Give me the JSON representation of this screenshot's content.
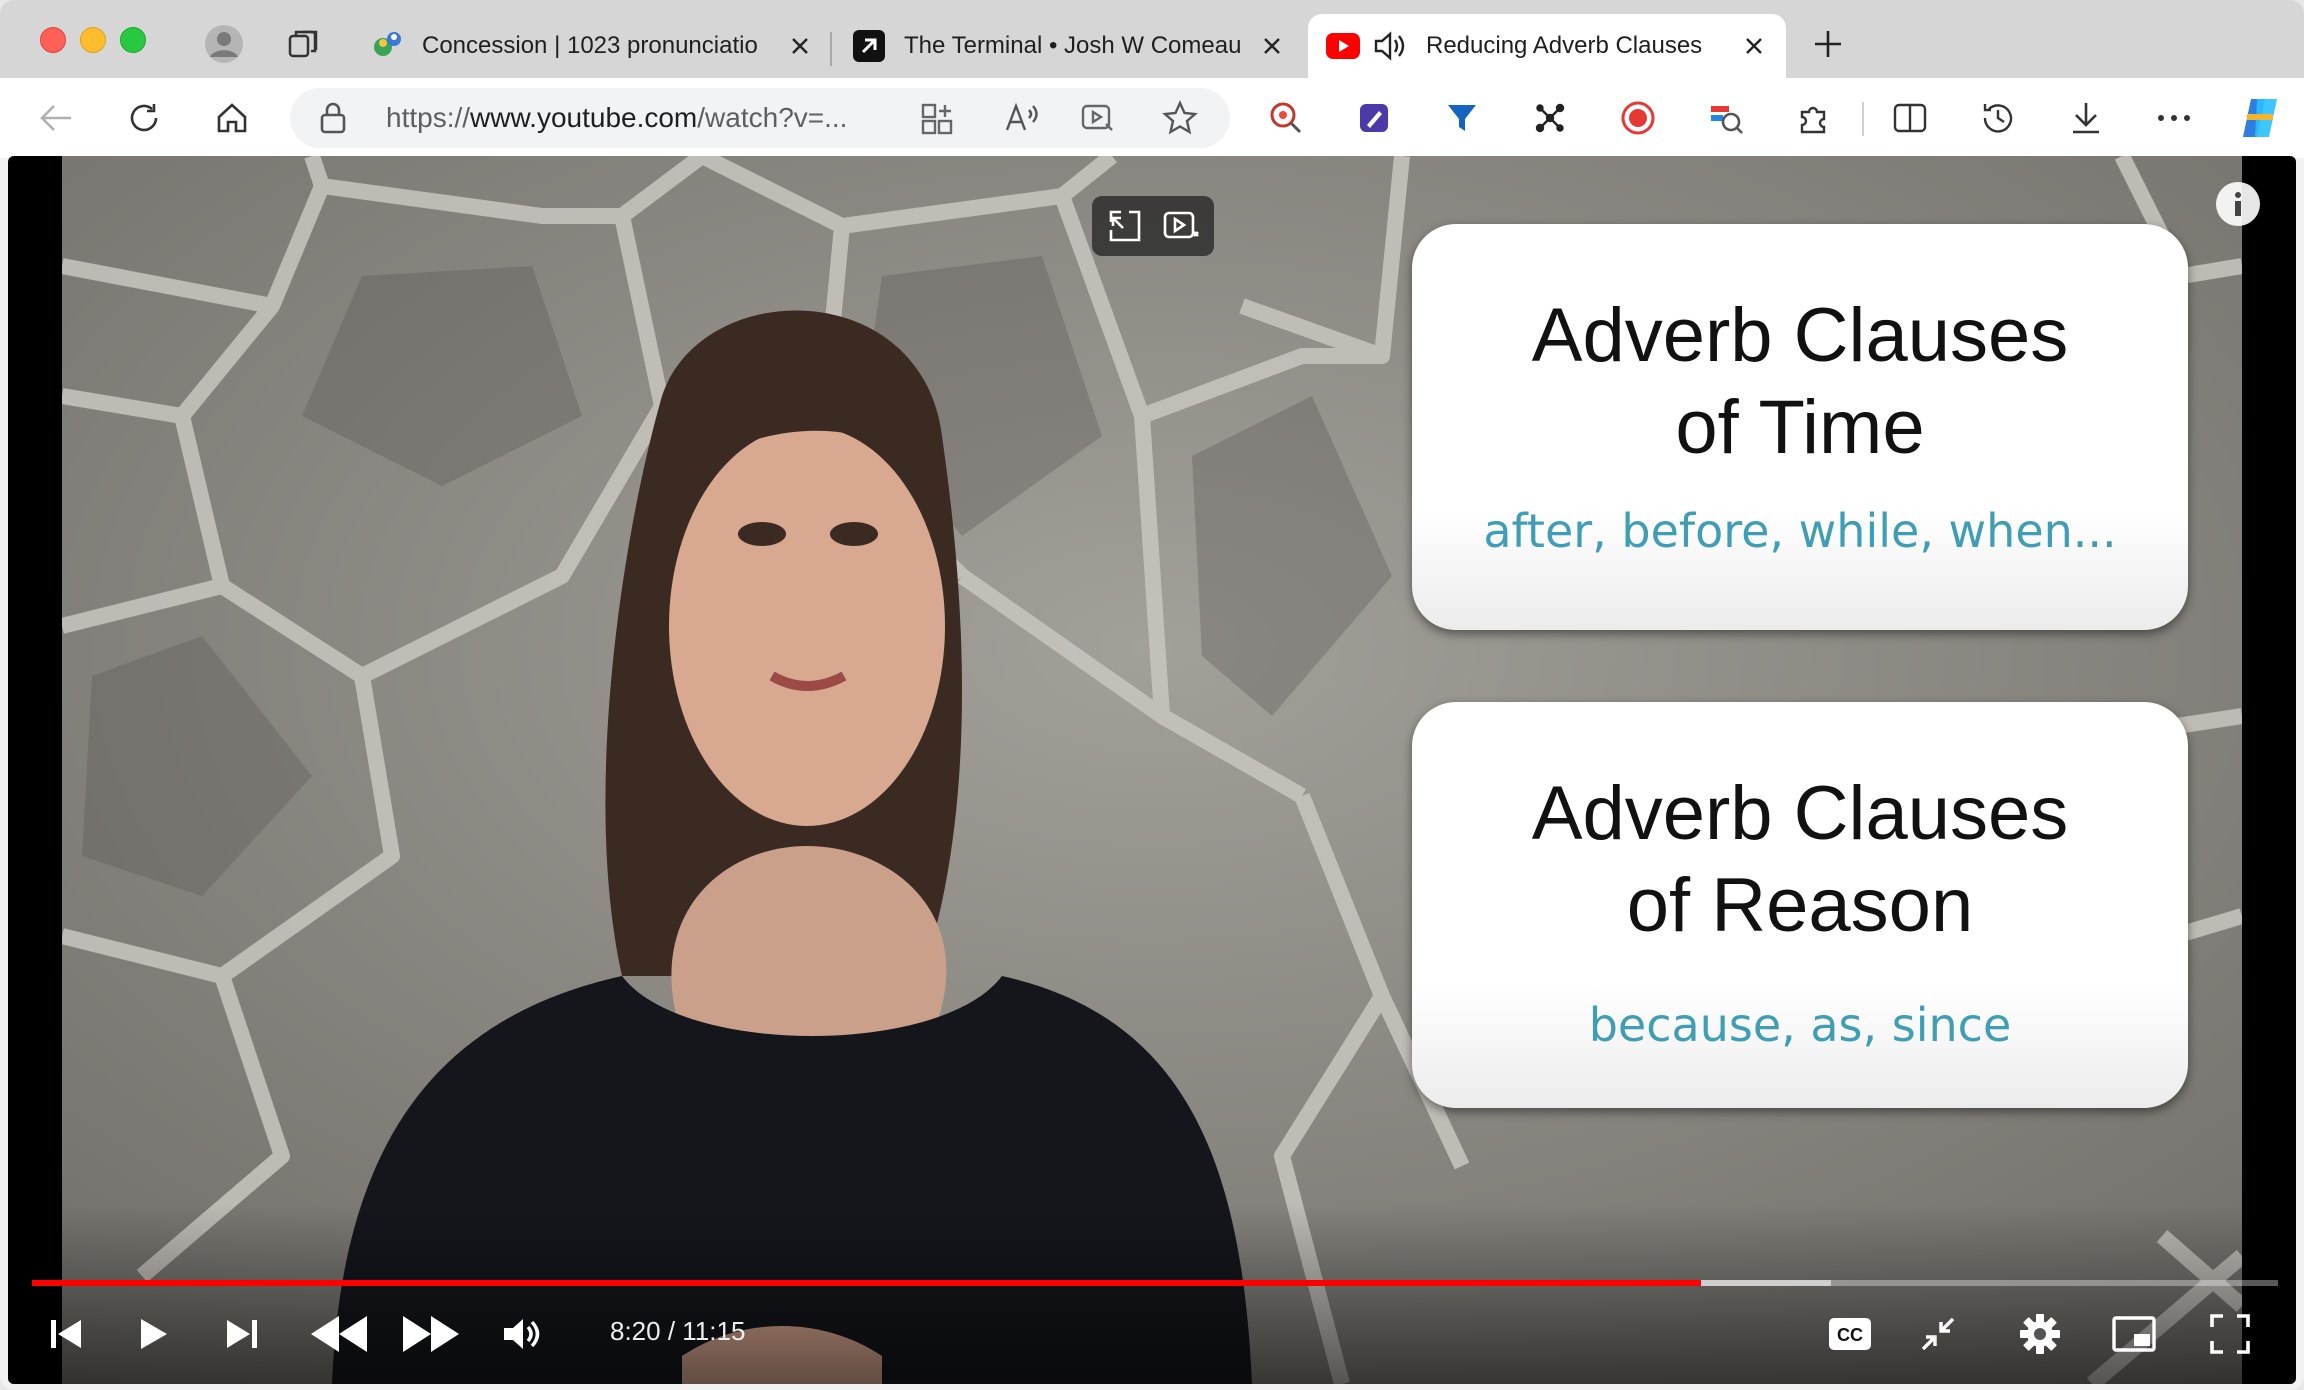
{
  "tabs": [
    {
      "title": "Concession | 1023 pronunciatio"
    },
    {
      "title": "The Terminal • Josh W Comeau"
    },
    {
      "title": "Reducing Adverb Clauses"
    }
  ],
  "address_bar": {
    "scheme": "https://",
    "domain": "www.youtube.com",
    "path": "/watch?v=..."
  },
  "video": {
    "cards": [
      {
        "heading_line1": "Adverb Clauses",
        "heading_line2": "of Time",
        "examples": "after, before, while, when..."
      },
      {
        "heading_line1": "Adverb Clauses",
        "heading_line2": "of Reason",
        "examples": "because, as, since"
      }
    ],
    "time_display": "8:20 / 11:15",
    "progress_fraction": 0.743,
    "buffer_fraction": 0.801,
    "colors": {
      "progress": "#ff0000",
      "card_examples": "#3f9db6"
    }
  }
}
